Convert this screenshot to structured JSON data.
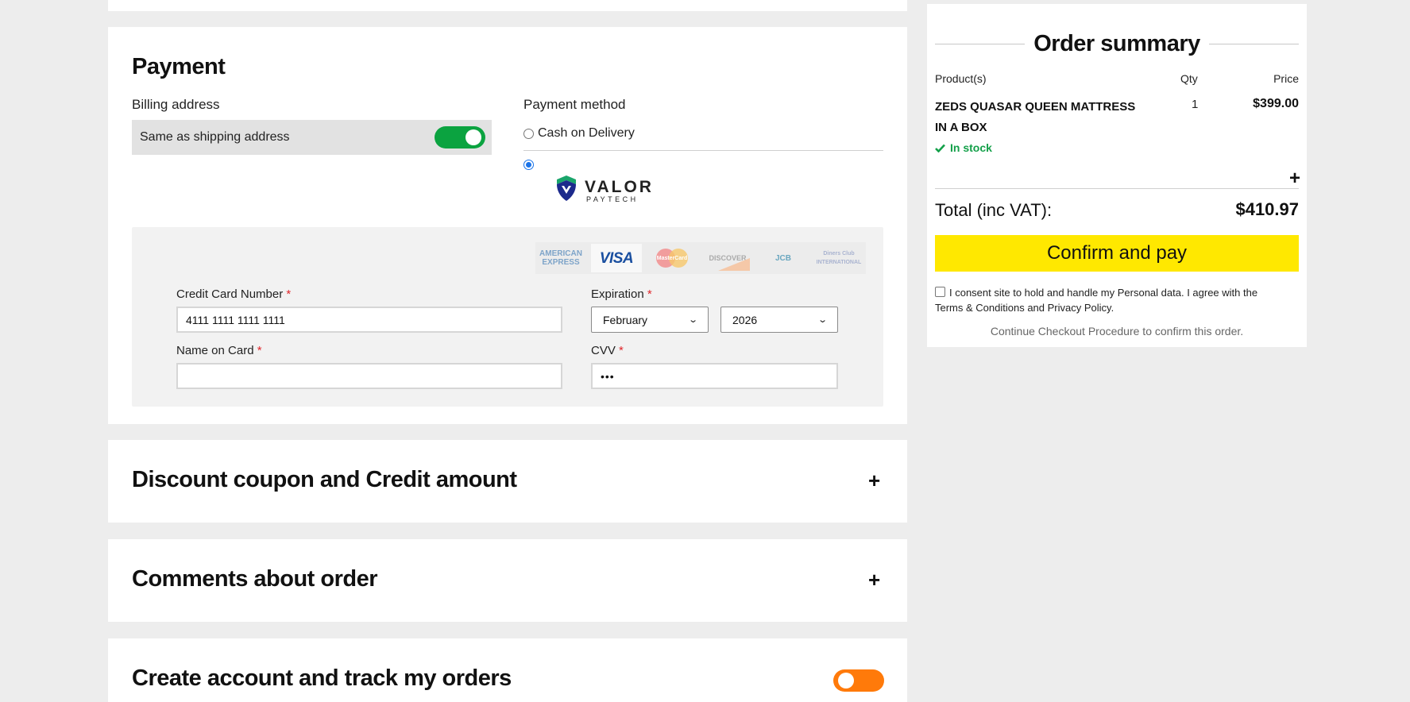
{
  "payment": {
    "title": "Payment",
    "billing_label": "Billing address",
    "same_shipping_label": "Same as shipping address",
    "same_shipping_on": true,
    "method_label": "Payment method",
    "cod_label": "Cash on Delivery",
    "valor": {
      "name": "VALOR",
      "sub": "PAYTECH"
    },
    "brands": {
      "amex": "AMERICAN EXPRESS",
      "visa": "VISA",
      "mastercard": "MasterCard",
      "discover": "DISCOVER",
      "jcb": "JCB",
      "diners": "Diners Club INTERNATIONAL"
    },
    "card": {
      "number_label": "Credit Card Number",
      "number_value": "4111 1111 1111 1111",
      "expiration_label": "Expiration",
      "month_value": "February",
      "year_value": "2026",
      "name_label": "Name on Card",
      "name_value": "",
      "cvv_label": "CVV",
      "cvv_value": "•••",
      "required_mark": "*"
    }
  },
  "sections": {
    "discount_title": "Discount coupon and Credit amount",
    "comments_title": "Comments about order",
    "account_title": "Create account and track my orders",
    "expand_symbol": "+"
  },
  "summary": {
    "title": "Order summary",
    "columns": {
      "product": "Product(s)",
      "qty": "Qty",
      "price": "Price"
    },
    "product": {
      "name": "ZEDS QUASAR QUEEN MATTRESS IN A BOX",
      "qty": "1",
      "price": "$399.00",
      "stock": "In stock"
    },
    "total_label": "Total (inc VAT):",
    "total_value": "$410.97",
    "confirm_label": "Confirm and pay",
    "consent_text": "I consent site to hold and handle my Personal data. I agree with the Terms & Conditions and Privacy Policy.",
    "continue_text": "Continue Checkout Procedure to confirm this order."
  },
  "colors": {
    "toggle_on": "#0ba340",
    "toggle_account": "#ff7a0a",
    "confirm_bg": "#ffe800",
    "stock_green": "#14a04a",
    "required_red": "#e0262b"
  }
}
